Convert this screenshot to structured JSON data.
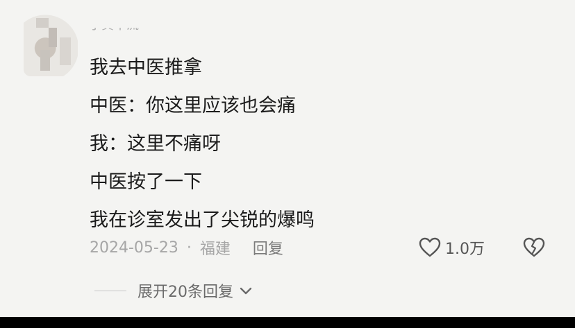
{
  "comment": {
    "username": "小黄十流",
    "lines": [
      "我去中医推拿",
      "中医：你这里应该也会痛",
      "我：这里不痛呀",
      "中医按了一下",
      "我在诊室发出了尖锐的爆鸣"
    ],
    "date": "2024-05-23",
    "separator": "·",
    "location": "福建",
    "reply_label": "回复",
    "like_count": "1.0万",
    "expand_label": "展开20条回复"
  },
  "icons": {
    "like": "heart-outline-icon",
    "dislike": "broken-heart-icon",
    "expand": "chevron-down-icon"
  },
  "colors": {
    "background": "#f4f4f2",
    "text": "#1b1b1b",
    "meta": "#a6a6a6"
  }
}
